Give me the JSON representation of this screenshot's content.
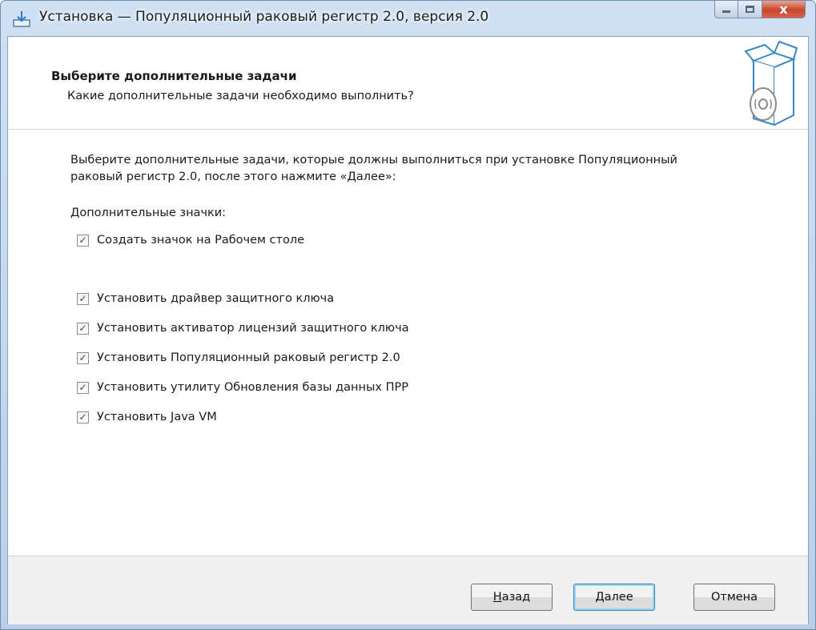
{
  "window": {
    "title": "Установка — Популяционный раковый регистр 2.0, версия 2.0",
    "caption_close": "x"
  },
  "header": {
    "title": "Выберите дополнительные задачи",
    "subtitle": "Какие дополнительные задачи необходимо выполнить?",
    "icon": "install-box-icon"
  },
  "body": {
    "description_line1": "Выберите дополнительные задачи, которые должны выполниться при установке Популяционный",
    "description_line2": "раковый регистр 2.0, после этого нажмите «Далее»:",
    "group_label": "Дополнительные значки:",
    "tasks": [
      {
        "label": "Создать значок на Рабочем столе",
        "checked": true
      },
      {
        "label": "Установить драйвер защитного ключа",
        "checked": true
      },
      {
        "label": "Установить активатор лицензий защитного ключа",
        "checked": true
      },
      {
        "label": "Установить Популяционный раковый регистр 2.0",
        "checked": true
      },
      {
        "label": "Установить утилиту Обновления базы данных ПРР",
        "checked": true
      },
      {
        "label": "Установить Java VM",
        "checked": true
      }
    ]
  },
  "footer": {
    "back_label": "Назад",
    "next_label": "Далее",
    "cancel_label": "Отмена"
  },
  "icons": {
    "app": "installer-icon",
    "minimize": "minimize-icon",
    "maximize": "maximize-icon",
    "close": "close-icon",
    "checkmark": "checkmark-icon"
  },
  "colors": {
    "title_bar": "#c3d6ee",
    "close_button": "#c9452c",
    "checkmark": "#2a4d7f",
    "footer": "#f0f0f0"
  }
}
